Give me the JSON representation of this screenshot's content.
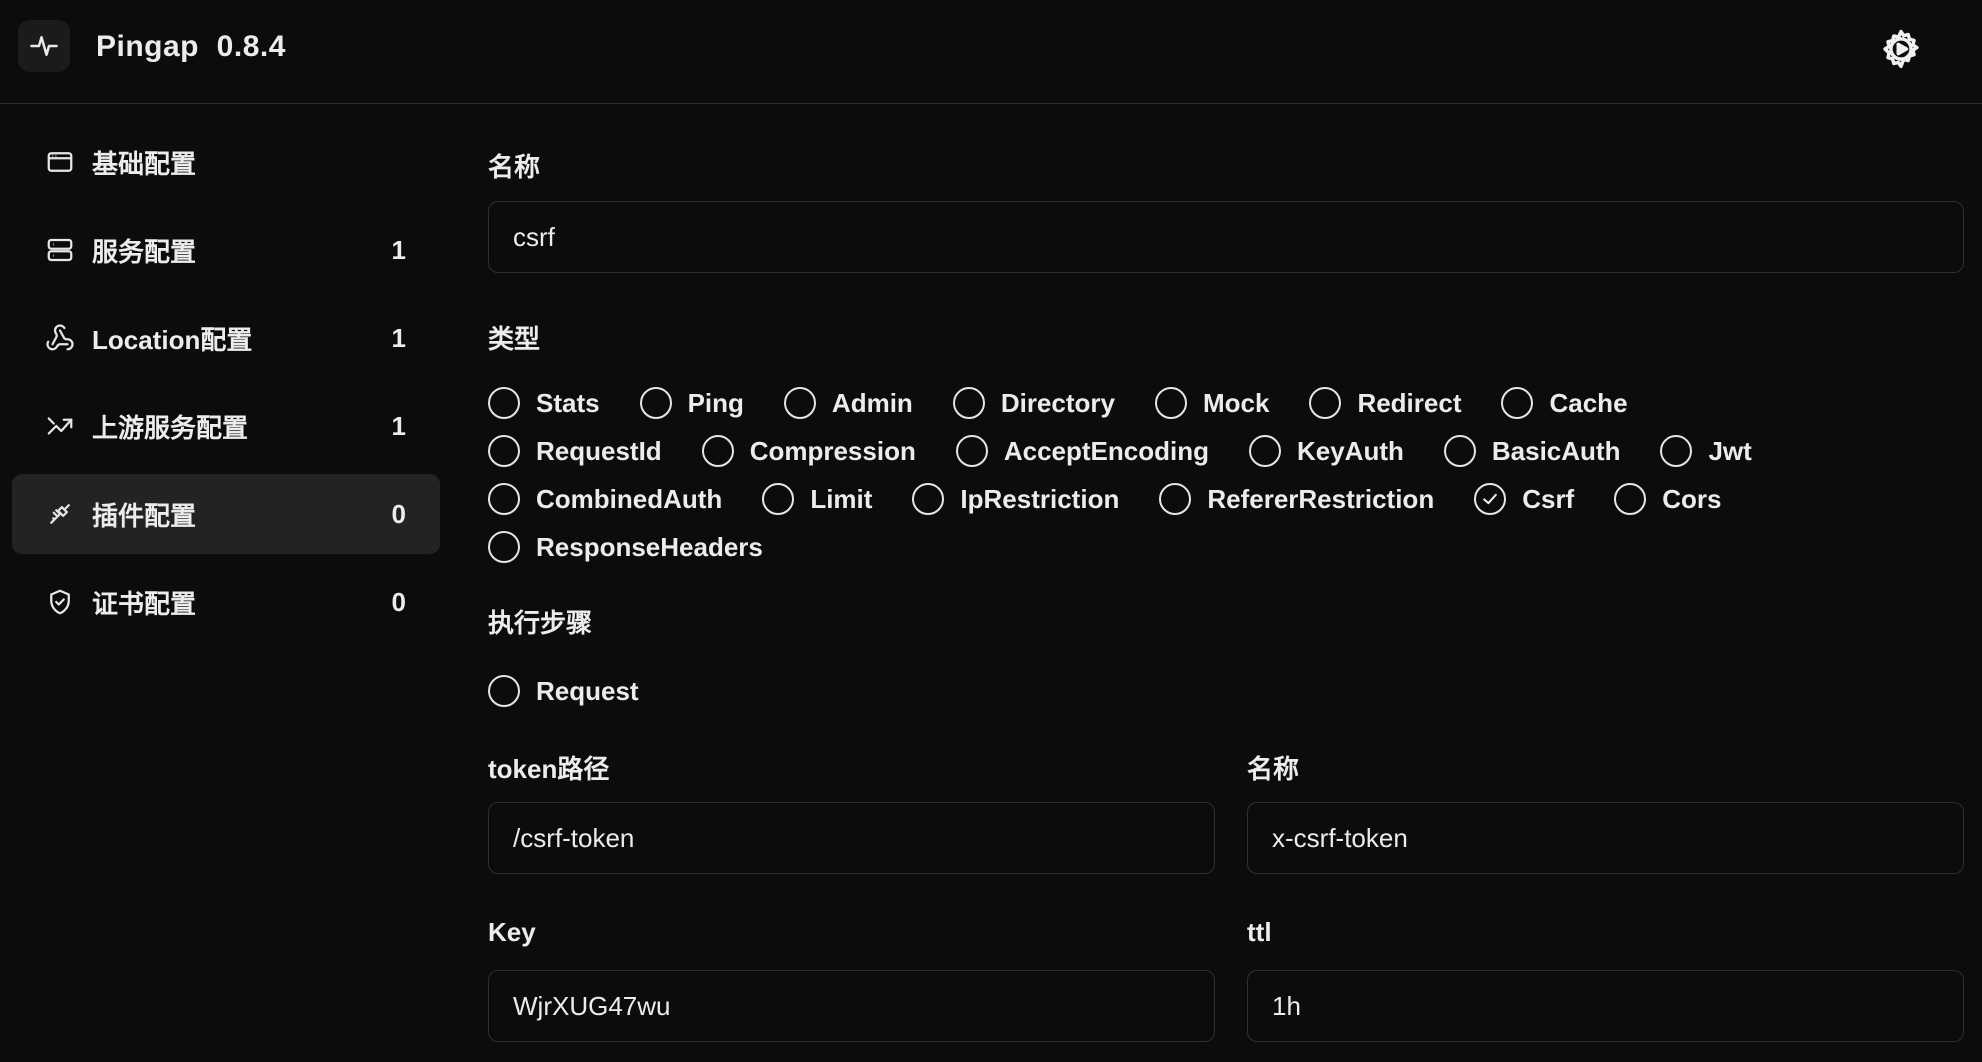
{
  "header": {
    "app_name": "Pingap  0.8.4",
    "logo_icon": "activity-pulse-icon",
    "settings_icon": "gear-play-icon"
  },
  "sidebar": {
    "items": [
      {
        "label": "基础配置",
        "count": "",
        "icon": "browser-window-icon",
        "active": false
      },
      {
        "label": "服务配置",
        "count": "1",
        "icon": "server-icon",
        "active": false
      },
      {
        "label": "Location配置",
        "count": "1",
        "icon": "webhook-icon",
        "active": false
      },
      {
        "label": "上游服务配置",
        "count": "1",
        "icon": "trending-up-icon",
        "active": false
      },
      {
        "label": "插件配置",
        "count": "0",
        "icon": "plug-icon",
        "active": true
      },
      {
        "label": "证书配置",
        "count": "0",
        "icon": "shield-check-icon",
        "active": false
      }
    ]
  },
  "form": {
    "name_label": "名称",
    "name_value": "csrf",
    "type_label": "类型",
    "type_rows": [
      [
        "Stats",
        "Ping",
        "Admin",
        "Directory",
        "Mock",
        "Redirect",
        "Cache"
      ],
      [
        "RequestId",
        "Compression",
        "AcceptEncoding",
        "KeyAuth",
        "BasicAuth",
        "Jwt"
      ],
      [
        "CombinedAuth",
        "Limit",
        "IpRestriction",
        "RefererRestriction",
        "Csrf",
        "Cors"
      ],
      [
        "ResponseHeaders"
      ]
    ],
    "type_selected": "Csrf",
    "step_label": "执行步骤",
    "step_options": [
      "Request"
    ],
    "token_path_label": "token路径",
    "token_path_value": "/csrf-token",
    "token_name_label": "名称",
    "token_name_value": "x-csrf-token",
    "key_label": "Key",
    "key_value": "WjrXUG47wu",
    "ttl_label": "ttl",
    "ttl_value": "1h"
  },
  "colors": {
    "background": "#0c0c0c",
    "active_nav": "#232323",
    "border": "#2f2f2f",
    "text": "#ececec"
  }
}
